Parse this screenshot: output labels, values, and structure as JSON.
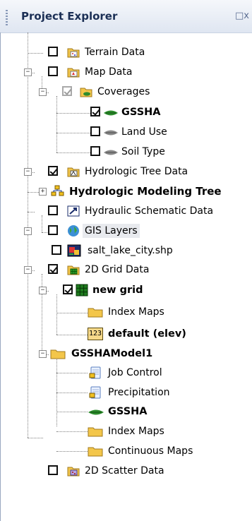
{
  "panel": {
    "title": "Project Explorer",
    "close_glyph": "□",
    "close_overflow": "x"
  },
  "tree": [
    {
      "label": "Terrain Data",
      "icon": "terrain-data-icon"
    },
    {
      "label": "Map Data",
      "icon": "map-data-icon"
    },
    {
      "label": "Coverages",
      "icon": "coverages-folder-icon"
    },
    {
      "label": "GSSHA",
      "icon": "coverage-icon"
    },
    {
      "label": "Land Use",
      "icon": "coverage-icon"
    },
    {
      "label": "Soil Type",
      "icon": "coverage-icon"
    },
    {
      "label": "Hydrologic Tree Data",
      "icon": "hydrologic-tree-icon"
    },
    {
      "label": "Hydrologic Modeling Tree",
      "icon": "modeling-tree-icon"
    },
    {
      "label": "Hydraulic Schematic Data",
      "icon": "hydraulic-schematic-icon"
    },
    {
      "label": "GIS Layers",
      "icon": "globe-icon"
    },
    {
      "label": "salt_lake_city.shp",
      "icon": "shapefile-icon"
    },
    {
      "label": "2D Grid Data",
      "icon": "grid-data-icon"
    },
    {
      "label": "new grid",
      "icon": "grid-icon"
    },
    {
      "label": "Index Maps",
      "icon": "folder-icon"
    },
    {
      "label": "default (elev)",
      "icon": "dataset-123-icon",
      "icon_text": "123"
    },
    {
      "label": "GSSHAModel1",
      "icon": "folder-icon"
    },
    {
      "label": "Job Control",
      "icon": "document-icon"
    },
    {
      "label": "Precipitation",
      "icon": "document-icon"
    },
    {
      "label": "GSSHA",
      "icon": "coverage-icon"
    },
    {
      "label": "Index Maps",
      "icon": "folder-icon"
    },
    {
      "label": "Continuous Maps",
      "icon": "folder-icon"
    },
    {
      "label": "2D Scatter Data",
      "icon": "scatter-data-icon"
    }
  ],
  "expanders": {
    "expanded": "−",
    "collapsed": "+"
  },
  "colors": {
    "header_text": "#1b2f55",
    "folder": "#f3c64a",
    "coverage_green": "#2d8c2d",
    "grid_green": "#1e7a1e"
  }
}
